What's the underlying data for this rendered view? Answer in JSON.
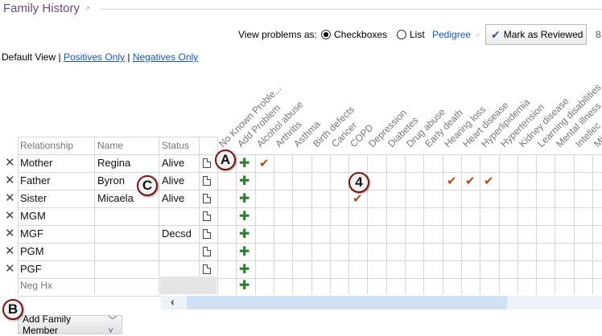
{
  "header": {
    "title": "Family History"
  },
  "toolbar": {
    "view_as_label": "View problems as:",
    "checkboxes_label": "Checkboxes",
    "list_label": "List",
    "pedigree_label": "Pedigree",
    "mark_reviewed_label": "Mark as Reviewed",
    "overflow_text": "8",
    "selected_view": "Checkboxes"
  },
  "view_filters": {
    "default_view": "Default View",
    "separator": "|",
    "positives_only": "Positives Only",
    "negatives_only": "Negatives Only"
  },
  "table": {
    "headers": {
      "relationship": "Relationship",
      "name": "Name",
      "status": "Status"
    },
    "rows": [
      {
        "relationship": "Mother",
        "name": "Regina",
        "status": "Alive"
      },
      {
        "relationship": "Father",
        "name": "Byron",
        "status": "Alive"
      },
      {
        "relationship": "Sister",
        "name": "Micaela",
        "status": "Alive"
      },
      {
        "relationship": "MGM",
        "name": "",
        "status": ""
      },
      {
        "relationship": "MGF",
        "name": "",
        "status": "Decsd"
      },
      {
        "relationship": "PGM",
        "name": "",
        "status": ""
      },
      {
        "relationship": "PGF",
        "name": "",
        "status": ""
      }
    ],
    "neg_hx_label": "Neg Hx",
    "problem_columns": [
      "No Known Proble...",
      "Add Problem",
      "Alcohol abuse",
      "Arthritis",
      "Asthma",
      "Birth defects",
      "Cancer",
      "COPD",
      "Depression",
      "Diabetes",
      "Drug abuse",
      "Early death",
      "Hearing loss",
      "Heart disease",
      "Hyperlipidemia",
      "Hypertension",
      "Kidney disease",
      "Learning disabilities",
      "Mental illness",
      "Intellec",
      "Mi"
    ],
    "checked": [
      {
        "row": "Mother",
        "problem": "Alcohol abuse"
      },
      {
        "row": "Father",
        "problem": "Hearing loss"
      },
      {
        "row": "Father",
        "problem": "Heart disease"
      },
      {
        "row": "Father",
        "problem": "Hyperlipidemia"
      },
      {
        "row": "Sister",
        "problem": "COPD"
      }
    ]
  },
  "footer": {
    "add_family_member_label": "Add Family Member"
  },
  "callouts": [
    "A",
    "B",
    "C",
    "4"
  ],
  "colors": {
    "title": "#6b4a7a",
    "link": "#1a56b8",
    "check": "#b84a1a",
    "plus": "#2e7d32",
    "callout_border": "#7a1515"
  },
  "icons": {
    "delete": "close-x-icon",
    "note": "document-icon",
    "add": "plus-icon",
    "reviewed": "checkmark-icon",
    "popout": "popout-icon",
    "scroll_left": "chevron-left-icon",
    "add_menu": "chevron-double-down-icon"
  }
}
